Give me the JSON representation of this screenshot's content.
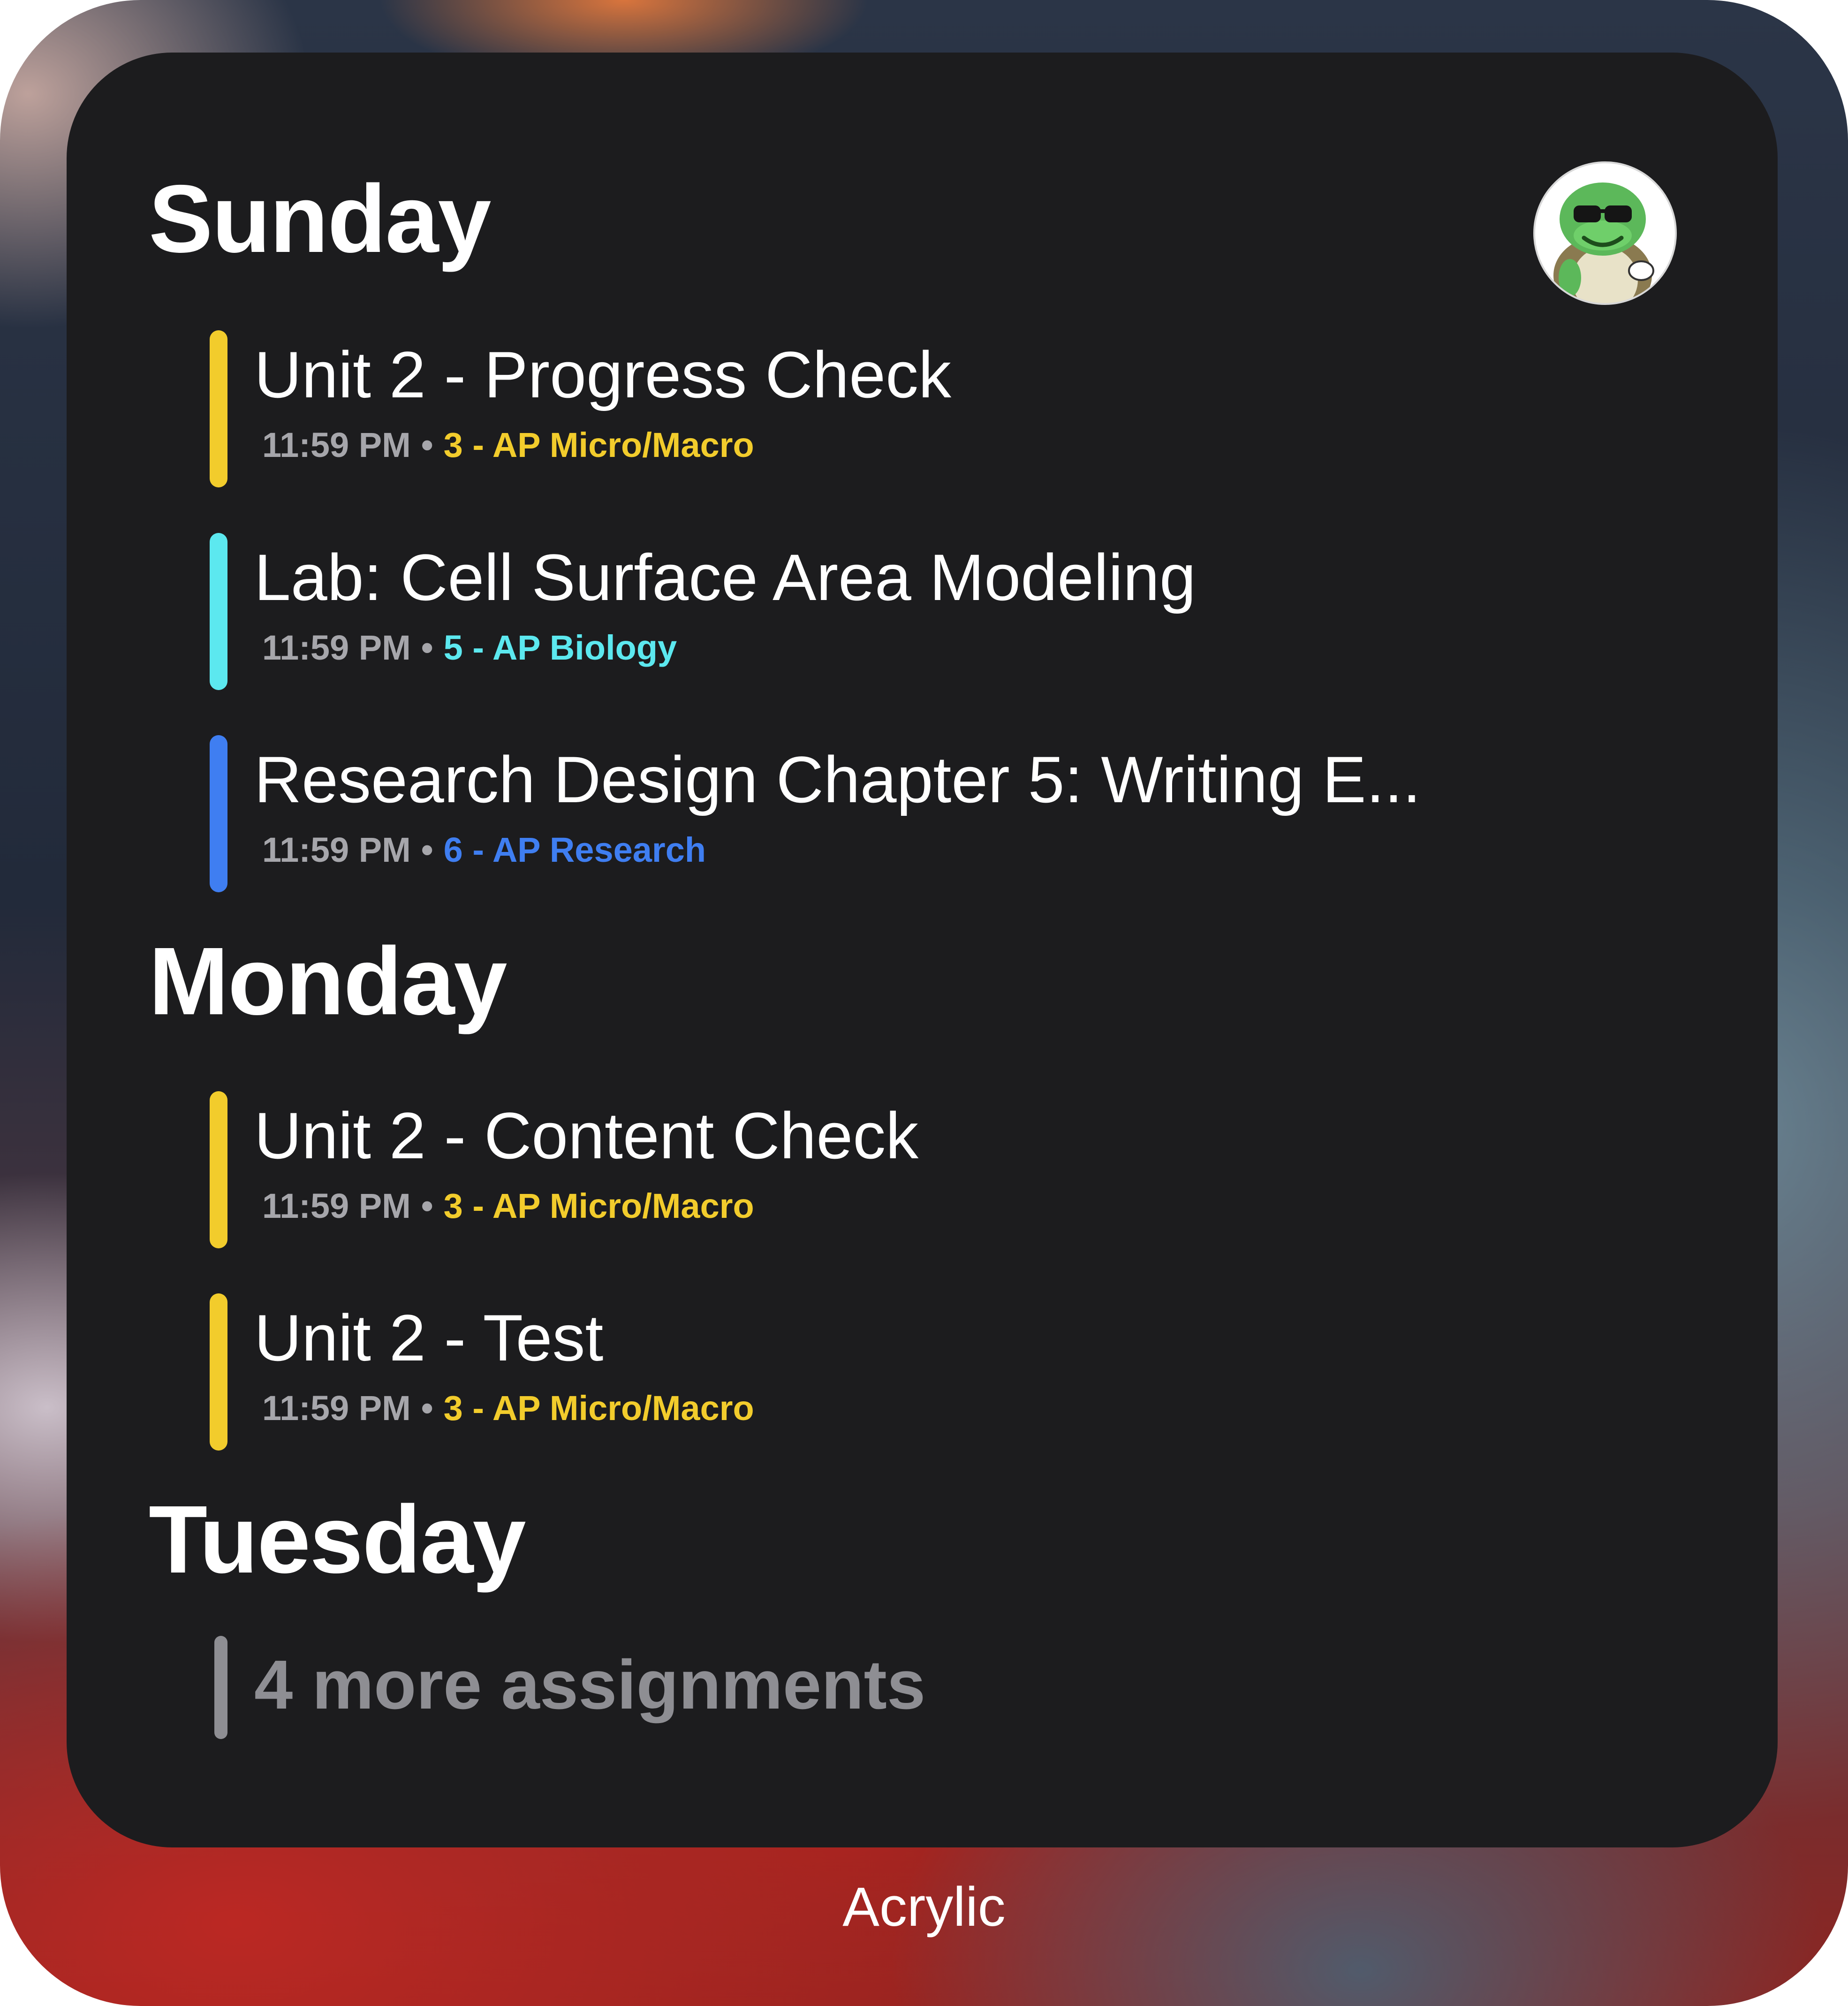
{
  "colors": {
    "widget_background": "#1c1c1e",
    "heading_text": "#ffffff",
    "time_text": "#a6a6ab",
    "more_indicator": "#8e8e93"
  },
  "avatar": {
    "icon": "turtle-with-sunglasses-avatar"
  },
  "days": [
    {
      "heading": "Sunday",
      "assignments": [
        {
          "title": "Unit 2 - Progress Check",
          "time": "11:59 PM",
          "separator": "•",
          "course": "3 - AP Micro/Macro",
          "color": "#f2cc2c"
        },
        {
          "title": "Lab: Cell Surface Area Modeling",
          "time": "11:59 PM",
          "separator": "•",
          "course": "5 - AP Biology",
          "color": "#5ce8ef"
        },
        {
          "title": "Research Design Chapter 5:  Writing E...",
          "time": "11:59 PM",
          "separator": "•",
          "course": "6 - AP Research",
          "color": "#3f7ef1"
        }
      ]
    },
    {
      "heading": "Monday",
      "assignments": [
        {
          "title": "Unit 2 - Content Check",
          "time": "11:59 PM",
          "separator": "•",
          "course": "3 - AP Micro/Macro",
          "color": "#f2cc2c"
        },
        {
          "title": "Unit 2 - Test",
          "time": "11:59 PM",
          "separator": "•",
          "course": "3 - AP Micro/Macro",
          "color": "#f2cc2c"
        }
      ]
    },
    {
      "heading": "Tuesday",
      "more": "4 more assignments"
    }
  ],
  "app_name": "Acrylic"
}
